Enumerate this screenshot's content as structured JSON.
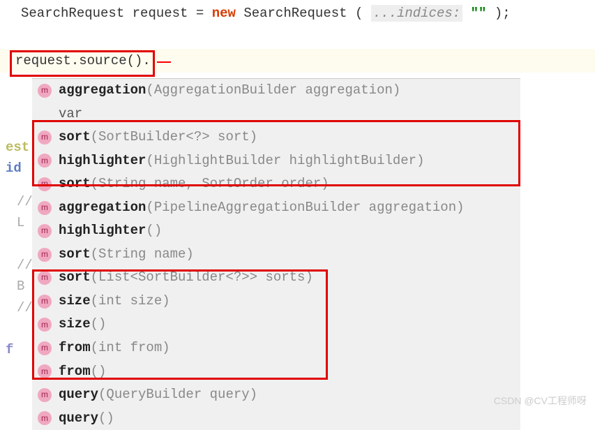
{
  "code": {
    "line1": {
      "type": "SearchRequest",
      "var": "request",
      "eq": "=",
      "newKw": "new",
      "ctor": "SearchRequest",
      "open": "(",
      "hint": "...indices:",
      "strLit": "\"\"",
      "close": ");"
    },
    "sourceLine": "request.source()."
  },
  "suggestions": [
    {
      "icon": "m",
      "name": "aggregation",
      "params": "(AggregationBuilder aggregation)"
    },
    {
      "icon": "",
      "name": "var",
      "params": ""
    },
    {
      "icon": "m",
      "name": "sort",
      "params": "(SortBuilder<?> sort)"
    },
    {
      "icon": "m",
      "name": "highlighter",
      "params": "(HighlightBuilder highlightBuilder)"
    },
    {
      "icon": "m",
      "name": "sort",
      "params": "(String name, SortOrder order)"
    },
    {
      "icon": "m",
      "name": "aggregation",
      "params": "(PipelineAggregationBuilder aggregation)"
    },
    {
      "icon": "m",
      "name": "highlighter",
      "params": "()"
    },
    {
      "icon": "m",
      "name": "sort",
      "params": "(String name)"
    },
    {
      "icon": "m",
      "name": "sort",
      "params": "(List<SortBuilder<?>> sorts)"
    },
    {
      "icon": "m",
      "name": "size",
      "params": "(int size)"
    },
    {
      "icon": "m",
      "name": "size",
      "params": "()"
    },
    {
      "icon": "m",
      "name": "from",
      "params": "(int from)"
    },
    {
      "icon": "m",
      "name": "from",
      "params": "()"
    },
    {
      "icon": "m",
      "name": "query",
      "params": "(QueryBuilder query)"
    },
    {
      "icon": "m",
      "name": "query",
      "params": "()"
    }
  ],
  "gutter": {
    "est": "est",
    "id": "id",
    "slash": "//",
    "L": "L",
    "B": "B",
    "f": "f"
  },
  "watermark": "CSDN @CV工程师呀"
}
